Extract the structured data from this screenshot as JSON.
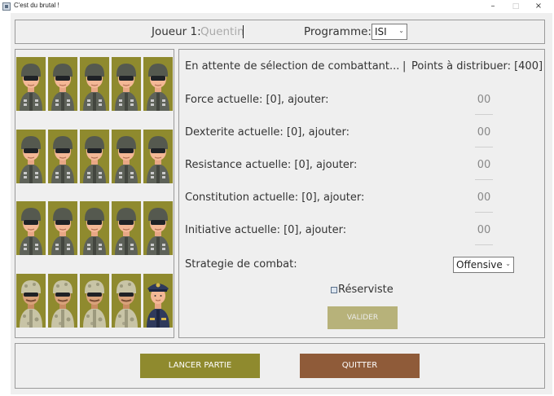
{
  "window": {
    "title": "C'est du brutal !",
    "controls": [
      "–",
      "□",
      "×"
    ]
  },
  "header": {
    "player_label": "Joueur 1:",
    "player_value": "Quentin",
    "program_label": "Programme:",
    "program_value": "ISI"
  },
  "status": {
    "waiting_text": "En attente de sélection de combattant...",
    "separator": "|",
    "points_text": "Points à distribuer: [400]"
  },
  "stats": [
    {
      "label": "Force actuelle: [0], ajouter:",
      "value": "00"
    },
    {
      "label": "Dexterite actuelle: [0], ajouter:",
      "value": "00"
    },
    {
      "label": "Resistance actuelle: [0], ajouter:",
      "value": "00"
    },
    {
      "label": "Constitution actuelle: [0], ajouter:",
      "value": "00"
    },
    {
      "label": "Initiative actuelle: [0], ajouter:",
      "value": "00"
    }
  ],
  "strategy": {
    "label": "Strategie de combat:",
    "value": "Offensive"
  },
  "reserve": {
    "label": "Réserviste",
    "checked": false
  },
  "buttons": {
    "validate": "VALIDER",
    "launch": "LANCER PARTIE",
    "quit": "QUITTER"
  },
  "fighters": {
    "rows": [
      [
        "soldier",
        "soldier",
        "soldier",
        "soldier",
        "soldier"
      ],
      [
        "soldier",
        "soldier",
        "soldier",
        "soldier",
        "soldier"
      ],
      [
        "soldier",
        "soldier",
        "soldier",
        "soldier",
        "soldier"
      ],
      [
        "camo-soldier",
        "camo-soldier",
        "camo-soldier",
        "camo-soldier",
        "general"
      ]
    ]
  },
  "colors": {
    "olive": "#8f8a2e",
    "brown": "#8f5b39",
    "validate_disabled": "#b7b27a"
  }
}
